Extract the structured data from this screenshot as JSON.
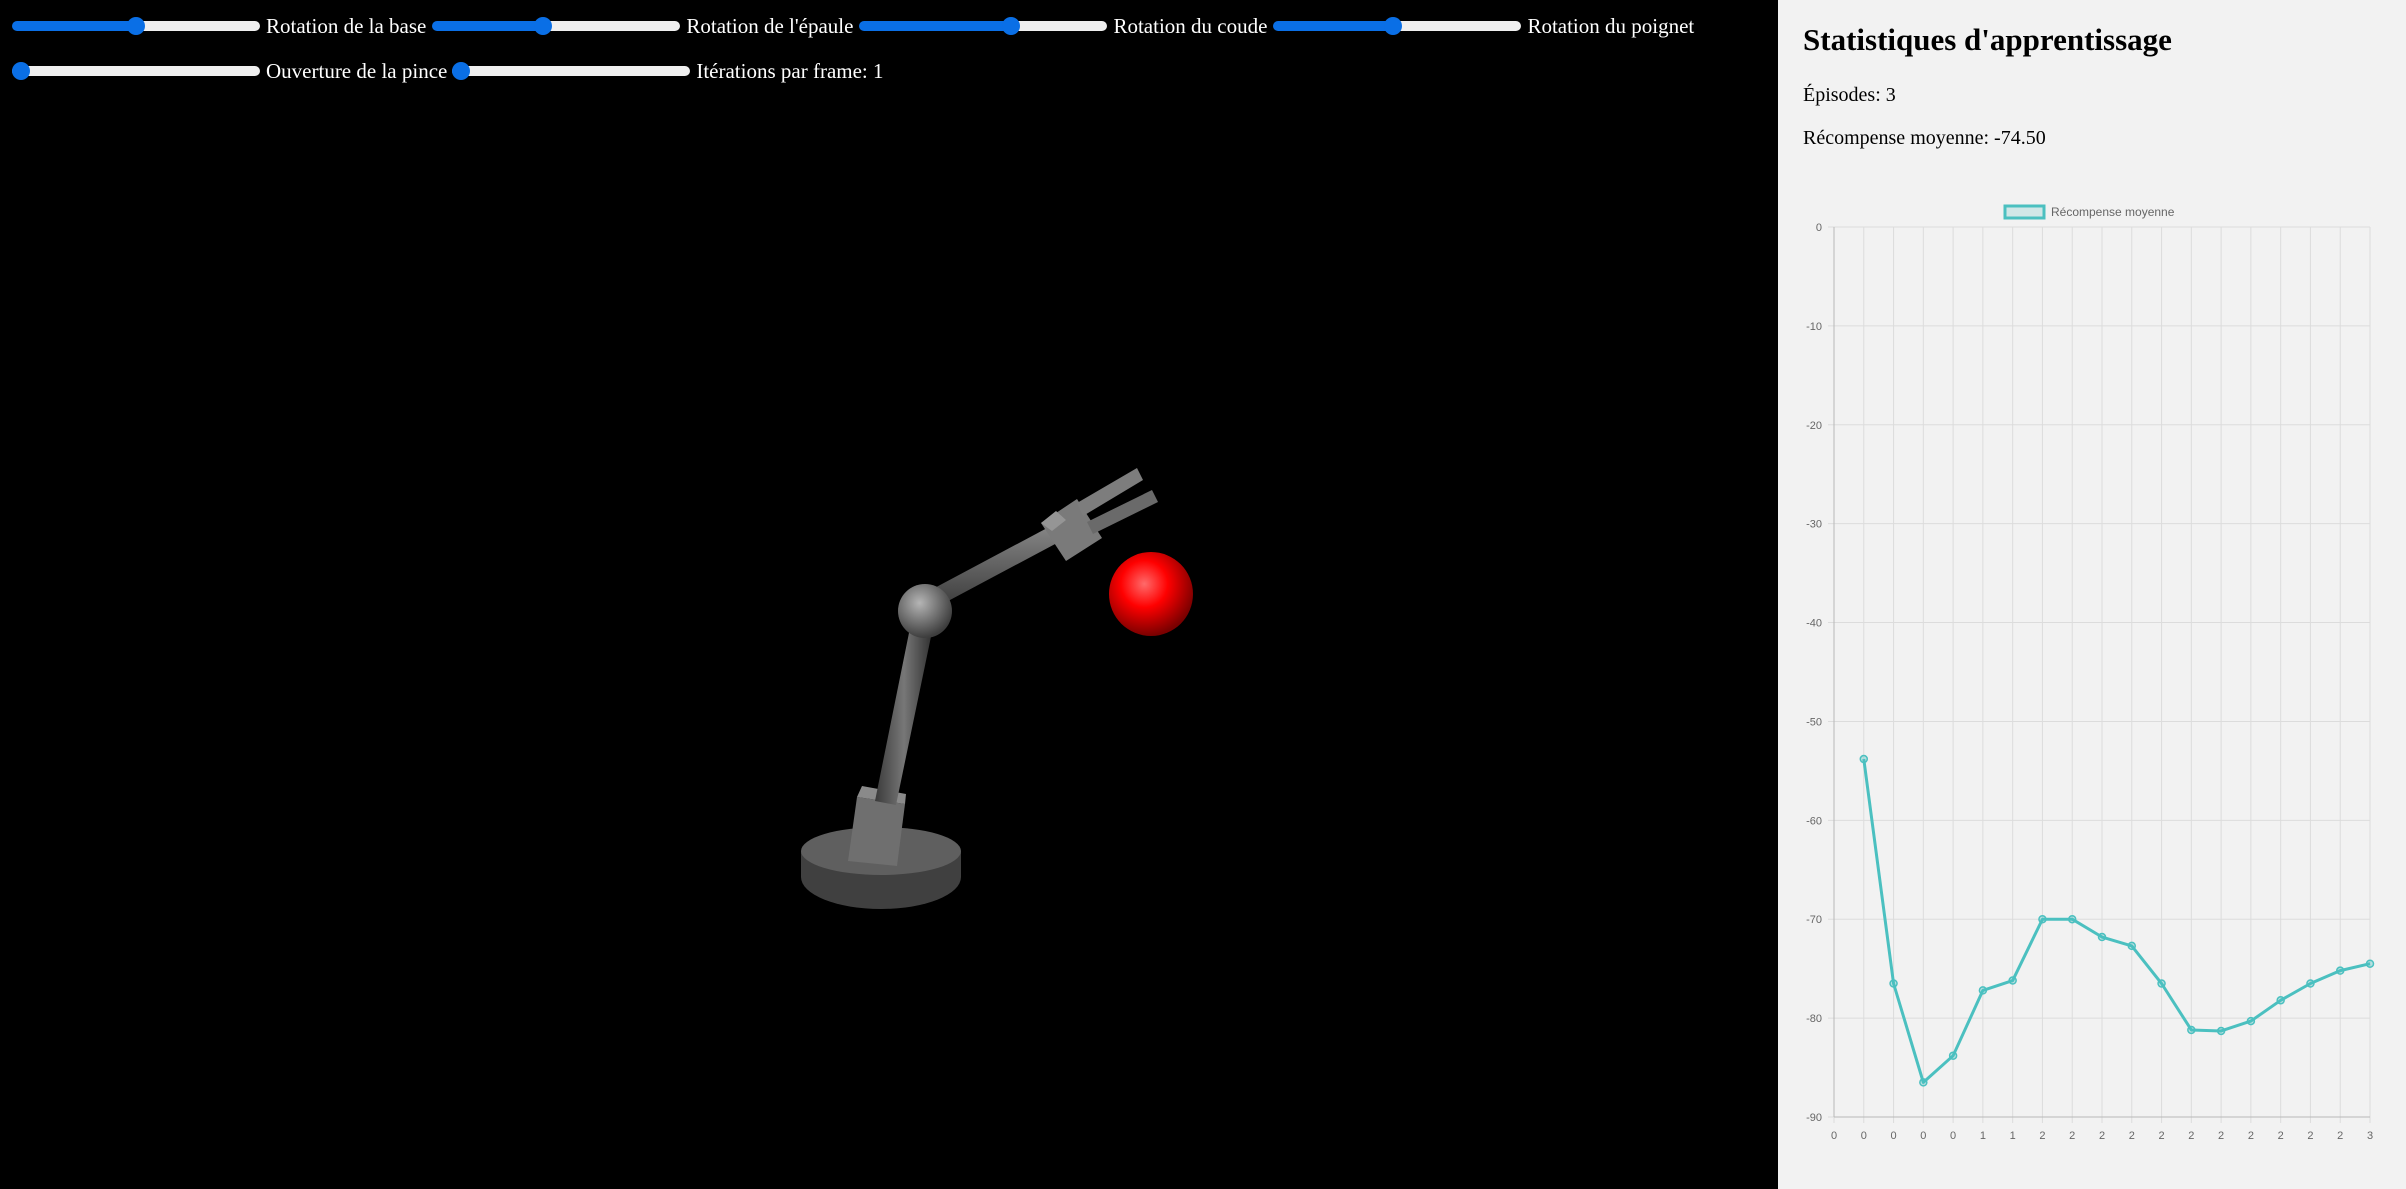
{
  "sliders": [
    {
      "id": "base",
      "label": "Rotation de la base",
      "value": 0.5
    },
    {
      "id": "shoulder",
      "label": "Rotation de l'épaule",
      "value": 0.44
    },
    {
      "id": "elbow",
      "label": "Rotation du coude",
      "value": 0.62
    },
    {
      "id": "wrist",
      "label": "Rotation du poignet",
      "value": 0.48
    },
    {
      "id": "gripper",
      "label": "Ouverture de la pince",
      "value": 0.0
    },
    {
      "id": "iterations",
      "label": "Itérations par frame: 1",
      "value": 0.0
    }
  ],
  "stats": {
    "title": "Statistiques d'apprentissage",
    "episodes_text": "Épisodes: 3",
    "avg_reward_text": "Récompense moyenne: -74.50"
  },
  "colors": {
    "slider_accent": "#0a6fe6",
    "line": "#4bc0c0",
    "target": "#ff0000",
    "panel_bg": "#f2f2f2"
  },
  "chart_data": {
    "type": "line",
    "title": "",
    "xlabel": "",
    "ylabel": "",
    "legend_position": "top",
    "grid": true,
    "ylim": [
      -90,
      0
    ],
    "y_ticks": [
      0,
      -10,
      -20,
      -30,
      -40,
      -50,
      -60,
      -70,
      -80,
      -90
    ],
    "x_ticks": [
      "0",
      "0",
      "0",
      "0",
      "0",
      "1",
      "1",
      "2",
      "2",
      "2",
      "2",
      "2",
      "2",
      "2",
      "2",
      "2",
      "2",
      "2",
      "3"
    ],
    "series": [
      {
        "name": "Récompense moyenne",
        "values": [
          -53.8,
          -76.5,
          -86.5,
          -83.8,
          -77.2,
          -76.2,
          -70.0,
          -70.0,
          -71.8,
          -72.7,
          -76.5,
          -81.2,
          -81.3,
          -80.3,
          -78.2,
          -76.5,
          -75.2,
          -74.5
        ]
      }
    ]
  }
}
